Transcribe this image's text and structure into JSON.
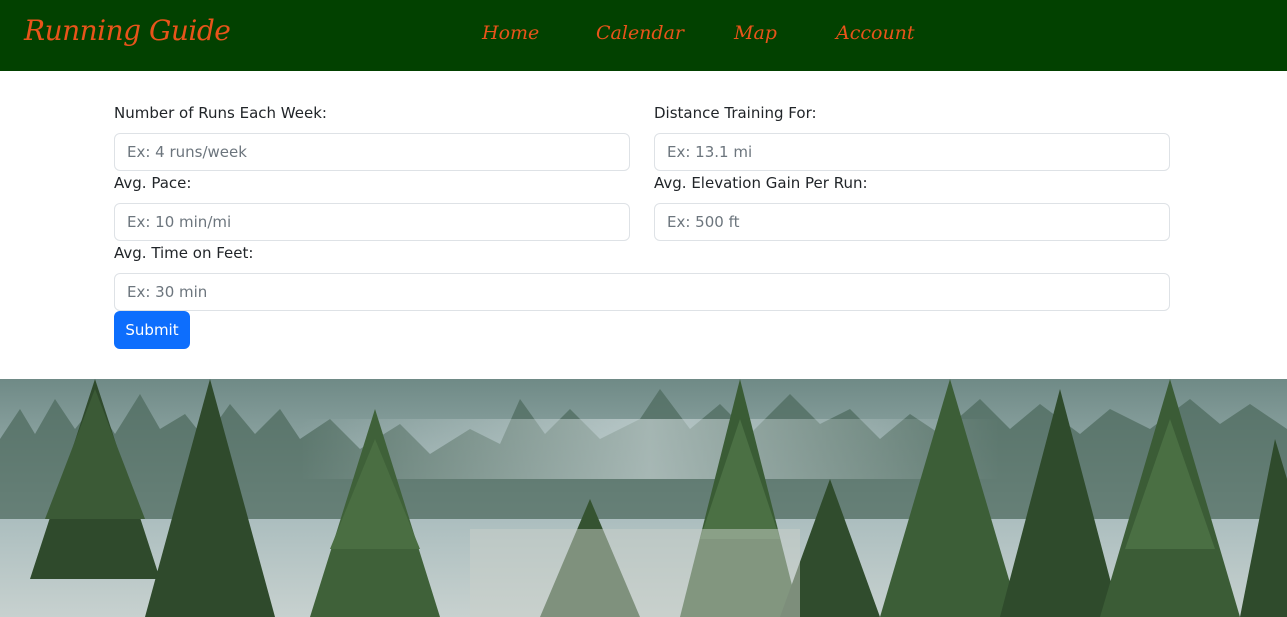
{
  "brand": "Running Guide",
  "nav": {
    "home": "Home",
    "calendar": "Calendar",
    "map": "Map",
    "account": "Account"
  },
  "form": {
    "runs_label": "Number of Runs Each Week:",
    "runs_placeholder": "Ex: 4 runs/week",
    "distance_label": "Distance Training For:",
    "distance_placeholder": "Ex: 13.1 mi",
    "pace_label": "Avg. Pace:",
    "pace_placeholder": "Ex: 10 min/mi",
    "elevation_label": "Avg. Elevation Gain Per Run:",
    "elevation_placeholder": "Ex: 500 ft",
    "time_label": "Avg. Time on Feet:",
    "time_placeholder": "Ex: 30 min",
    "submit_label": "Submit"
  },
  "colors": {
    "navbar_bg": "#024100",
    "nav_text": "#e8541a",
    "submit_bg": "#0d6efd"
  },
  "icons": {
    "hero_image": "misty-pine-forest-image"
  }
}
